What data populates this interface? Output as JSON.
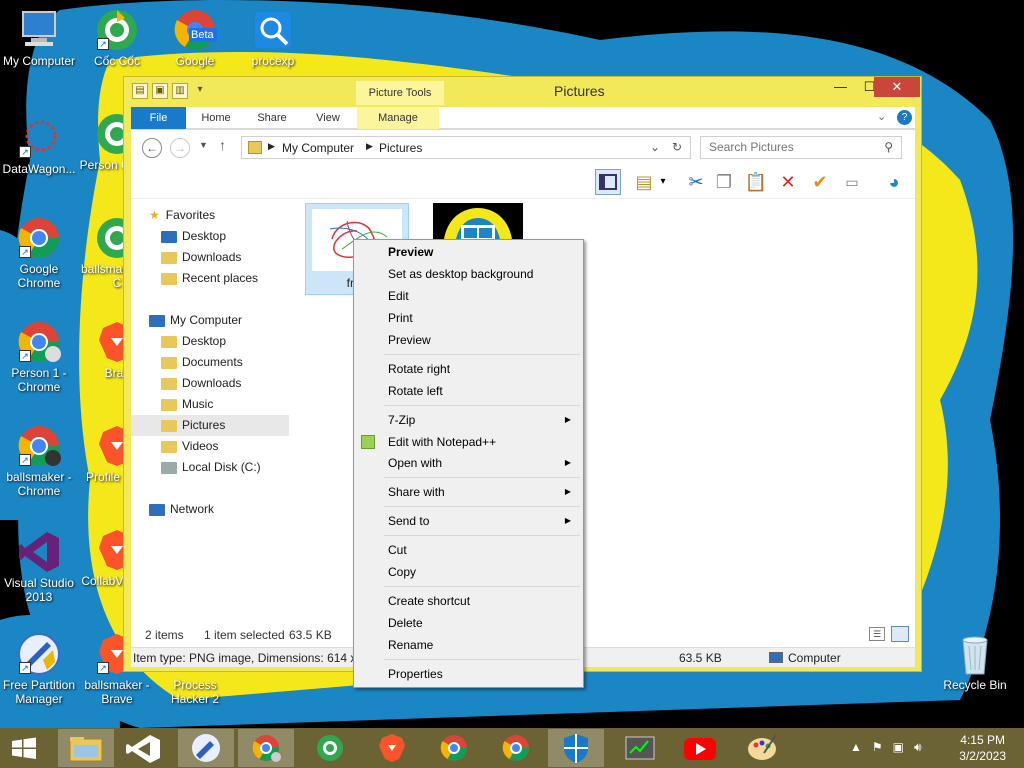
{
  "desktop": {
    "icons": [
      {
        "label": "My Computer"
      },
      {
        "label": "Cốc Cốc"
      },
      {
        "label": "Google"
      },
      {
        "label": "procexp"
      },
      {
        "label": "DataWagon..."
      },
      {
        "label": "Person Cốc C"
      },
      {
        "label": "Google Chrome"
      },
      {
        "label": "ballsmak Cốc C"
      },
      {
        "label": "Person 1 - Chrome"
      },
      {
        "label": "Brav"
      },
      {
        "label": "ballsmaker - Chrome"
      },
      {
        "label": "Profile Brav"
      },
      {
        "label": "Visual Studio 2013"
      },
      {
        "label": "CollabV - Bra"
      },
      {
        "label": "Free Partition Manager"
      },
      {
        "label": "ballsmaker - Brave"
      },
      {
        "label": "Process Hacker 2"
      },
      {
        "label": "Recycle Bin"
      }
    ],
    "beta_badge": "Beta"
  },
  "window": {
    "title": "Pictures",
    "contextual_tab_group": "Picture Tools",
    "tabs": {
      "file": "File",
      "home": "Home",
      "share": "Share",
      "view": "View",
      "manage": "Manage"
    },
    "address": {
      "crumb1": "My Computer",
      "crumb2": "Pictures"
    },
    "search_placeholder": "Search Pictures",
    "nav": {
      "favorites": "Favorites",
      "fav_desktop": "Desktop",
      "fav_downloads": "Downloads",
      "fav_recent": "Recent places",
      "computer": "My Computer",
      "desktop": "Desktop",
      "documents": "Documents",
      "downloads": "Downloads",
      "music": "Music",
      "pictures": "Pictures",
      "videos": "Videos",
      "localdisk": "Local Disk (C:)",
      "network": "Network"
    },
    "files": {
      "file1_caption": "free"
    },
    "status": {
      "items": "2 items",
      "selected": "1 item selected",
      "size": "63.5 KB",
      "details": "Item type: PNG image, Dimensions: 614 x 4",
      "size2": "63.5 KB",
      "location": "Computer"
    }
  },
  "context_menu": {
    "preview_bold": "Preview",
    "set_bg": "Set as desktop background",
    "edit": "Edit",
    "print": "Print",
    "preview": "Preview",
    "rotate_right": "Rotate right",
    "rotate_left": "Rotate left",
    "zip": "7-Zip",
    "notepad": "Edit with Notepad++",
    "open_with": "Open with",
    "share_with": "Share with",
    "send_to": "Send to",
    "cut": "Cut",
    "copy": "Copy",
    "create_shortcut": "Create shortcut",
    "delete": "Delete",
    "rename": "Rename",
    "properties": "Properties"
  },
  "taskbar": {
    "time": "4:15 PM",
    "date": "3/2/2023"
  },
  "colors": {
    "wallpaper_yellow": "#f4e81a",
    "wallpaper_blue": "#1a86c4",
    "window_frame": "#f1e85a",
    "file_tab": "#1979ca",
    "taskbar": "#6b6333",
    "close_button": "#c9463d"
  }
}
